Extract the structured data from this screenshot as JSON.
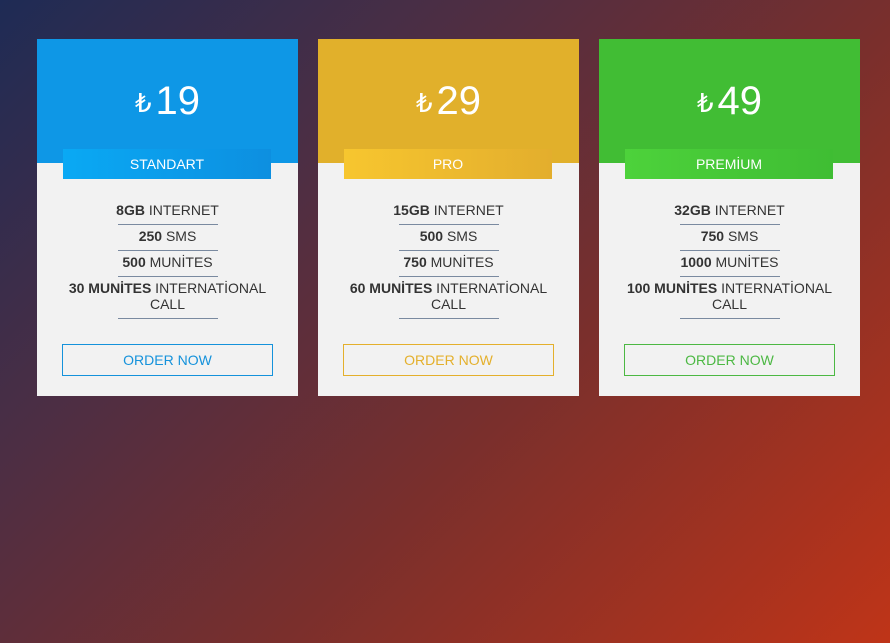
{
  "plans": [
    {
      "currency": "₺",
      "price": "19",
      "name": "STANDART",
      "features": [
        {
          "bold": "8GB",
          "text": " INTERNET"
        },
        {
          "bold": "250",
          "text": " SMS"
        },
        {
          "bold": "500",
          "text": " MUNİTES"
        },
        {
          "bold": "30 MUNİTES",
          "text": " INTERNATİONAL CALL"
        }
      ],
      "button": "ORDER NOW",
      "color": "#0e97e6"
    },
    {
      "currency": "₺",
      "price": "29",
      "name": "PRO",
      "features": [
        {
          "bold": "15GB",
          "text": " INTERNET"
        },
        {
          "bold": "500",
          "text": " SMS"
        },
        {
          "bold": "750",
          "text": " MUNİTES"
        },
        {
          "bold": "60 MUNİTES",
          "text": " INTERNATİONAL CALL"
        }
      ],
      "button": "ORDER NOW",
      "color": "#e1b02b"
    },
    {
      "currency": "₺",
      "price": "49",
      "name": "PREMİUM",
      "features": [
        {
          "bold": "32GB",
          "text": " INTERNET"
        },
        {
          "bold": "750",
          "text": " SMS"
        },
        {
          "bold": "1000",
          "text": " MUNİTES"
        },
        {
          "bold": "100 MUNİTES",
          "text": " INTERNATİONAL CALL"
        }
      ],
      "button": "ORDER NOW",
      "color": "#41bd34"
    }
  ]
}
